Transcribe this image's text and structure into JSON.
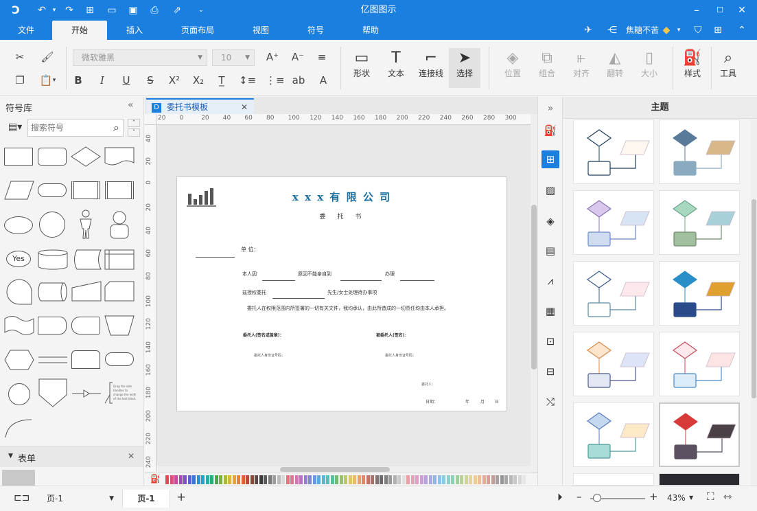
{
  "app": {
    "title": "亿图图示"
  },
  "quick_access": [
    "logo-icon",
    "undo-icon",
    "redo-icon",
    "new-icon",
    "open-icon",
    "save-icon",
    "print-icon",
    "export-icon",
    "customize-icon"
  ],
  "user": {
    "name": "焦糖不苦"
  },
  "menu": {
    "tabs": [
      "文件",
      "开始",
      "插入",
      "页面布局",
      "视图",
      "符号",
      "帮助"
    ],
    "active": "开始"
  },
  "ribbon": {
    "font_name": "微软雅黑",
    "font_size": "10",
    "tools": [
      {
        "label": "形状",
        "icon": "rectangle-icon"
      },
      {
        "label": "文本",
        "icon": "text-icon"
      },
      {
        "label": "连接线",
        "icon": "connector-icon"
      },
      {
        "label": "选择",
        "icon": "select-cursor-icon"
      }
    ],
    "arrange": [
      {
        "label": "位置"
      },
      {
        "label": "组合"
      },
      {
        "label": "对齐"
      },
      {
        "label": "翻转"
      },
      {
        "label": "大小"
      }
    ],
    "style_label": "样式",
    "tools_label": "工具"
  },
  "left_panel": {
    "title": "符号库",
    "search_placeholder": "搜索符号",
    "yes_label": "Yes",
    "note_text": "Drag the side handles to change the width of the text block.",
    "footer_section": "表单"
  },
  "document": {
    "tab_title": "委托书模板",
    "ruler_h": [
      "20",
      "0",
      "20",
      "40",
      "60",
      "80",
      "100",
      "120",
      "140",
      "160",
      "180",
      "200",
      "220",
      "240",
      "260",
      "280",
      "300"
    ],
    "ruler_v": [
      "40",
      "20",
      "0",
      "20",
      "40",
      "60",
      "80",
      "100",
      "120",
      "140",
      "160",
      "180",
      "200",
      "220",
      "240"
    ],
    "company": "x x x 有 限 公 司",
    "heading": "委　托　书",
    "unit_label": "单 位：",
    "line1_a": "本人因",
    "line1_b": "原因不能亲自到",
    "line1_c": "办理",
    "line2_a": "兹授权委托",
    "line2_b": "先生/女士处理待办事项",
    "body_text": "委托人在权限范围内所签署的一切有关文件，我均承认，由此所造成的一切责任均由本人承担。",
    "sign_left": "委托人(签名或盖章)：",
    "sign_right": "被委托人(签名)：",
    "id_left": "委托人身份证号码：",
    "id_right": "委托人身份证号码：",
    "principal": "委托人：",
    "date_label": "日期：",
    "year": "年",
    "month": "月",
    "day": "日"
  },
  "theme_panel": {
    "title": "主题"
  },
  "status": {
    "page_select": "页-1",
    "page_tab": "页-1",
    "zoom": "43%"
  },
  "colors": {
    "brand": "#1b7fe0",
    "company_text": "#1a6fa0"
  }
}
